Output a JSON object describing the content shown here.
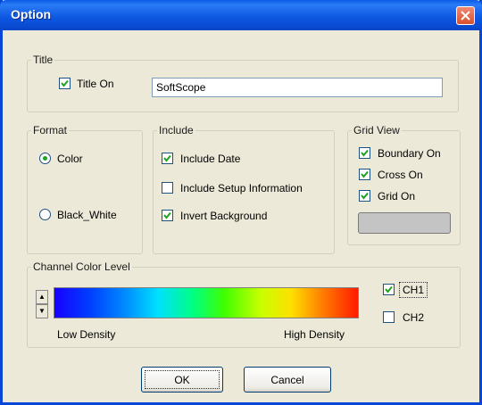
{
  "window": {
    "title": "Option"
  },
  "title_group": {
    "legend": "Title",
    "title_on": {
      "label": "Title On",
      "checked": true
    },
    "title_text": "SoftScope"
  },
  "format_group": {
    "legend": "Format",
    "options": [
      {
        "label": "Color",
        "selected": true
      },
      {
        "label": "Black_White",
        "selected": false
      }
    ]
  },
  "include_group": {
    "legend": "Include",
    "items": [
      {
        "label": "Include Date",
        "checked": true
      },
      {
        "label": "Include Setup Information",
        "checked": false
      },
      {
        "label": "Invert Background",
        "checked": true
      }
    ]
  },
  "grid_group": {
    "legend": "Grid View",
    "items": [
      {
        "label": "Boundary On",
        "checked": true
      },
      {
        "label": "Cross On",
        "checked": true
      },
      {
        "label": "Grid On",
        "checked": true
      }
    ]
  },
  "channel_group": {
    "legend": "Channel Color Level",
    "low_label": "Low Density",
    "high_label": "High Density",
    "spin_up": "▲",
    "spin_down": "▼",
    "channels": [
      {
        "label": "CH1",
        "checked": true
      },
      {
        "label": "CH2",
        "checked": false
      }
    ]
  },
  "buttons": {
    "ok": "OK",
    "cancel": "Cancel"
  },
  "colors": {
    "titlebar": "#0a5ae8",
    "dialog_bg": "#ece9d8",
    "check": "#21a121",
    "close": "#d8502e"
  },
  "icons": {
    "close": "close-icon",
    "check": "checkmark-icon"
  }
}
